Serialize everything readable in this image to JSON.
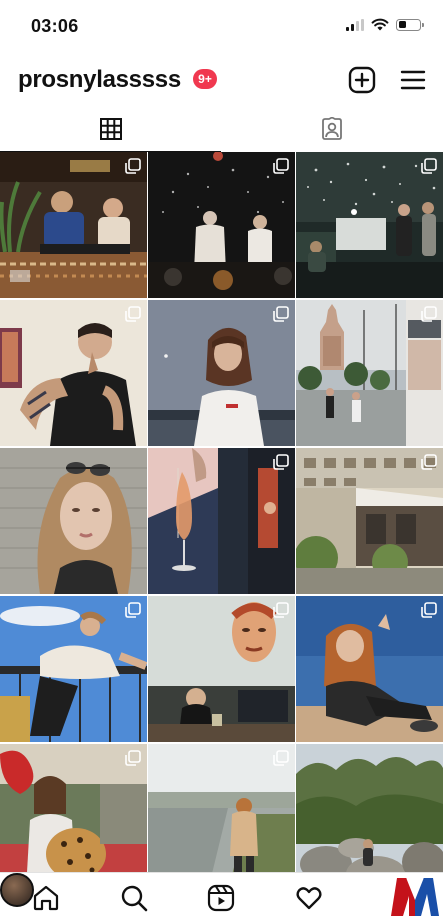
{
  "status_bar": {
    "time": "03:06"
  },
  "profile": {
    "username": "prosnylasssss",
    "notification_badge": "9+"
  },
  "header_icons": {
    "create": "plus-square-icon",
    "menu": "hamburger-menu-icon"
  },
  "tabs": [
    {
      "name": "posts",
      "icon": "grid-icon",
      "selected": true
    },
    {
      "name": "tagged",
      "icon": "tagged-person-icon",
      "selected": false
    }
  ],
  "bottom_nav": [
    "home-icon",
    "search-icon",
    "reels-icon",
    "heart-icon",
    "profile-avatar"
  ],
  "watermark": {
    "letters": "M",
    "colors": [
      "#c4121a",
      "#1a4fa8"
    ]
  },
  "posts": [
    {
      "subject": "dj-booth-party",
      "multi": true
    },
    {
      "subject": "concert-crowd-dark",
      "multi": true
    },
    {
      "subject": "party-confetti-stage",
      "multi": true
    },
    {
      "subject": "man-smoking-tattoos",
      "multi": true
    },
    {
      "subject": "woman-twilight-river",
      "multi": true
    },
    {
      "subject": "moscow-building-street",
      "multi": true
    },
    {
      "subject": "woman-sunglasses-selfie",
      "multi": false
    },
    {
      "subject": "champagne-glass-pour",
      "multi": true
    },
    {
      "subject": "soviet-hotel-facade",
      "multi": true
    },
    {
      "subject": "woman-balcony-leaning",
      "multi": true
    },
    {
      "subject": "man-under-mural",
      "multi": true
    },
    {
      "subject": "woman-peace-sign-rocks",
      "multi": true
    },
    {
      "subject": "woman-with-plush-leopard",
      "multi": true
    },
    {
      "subject": "woman-riverbank-walk",
      "multi": true
    },
    {
      "subject": "rocky-shore-trees",
      "multi": false
    }
  ]
}
